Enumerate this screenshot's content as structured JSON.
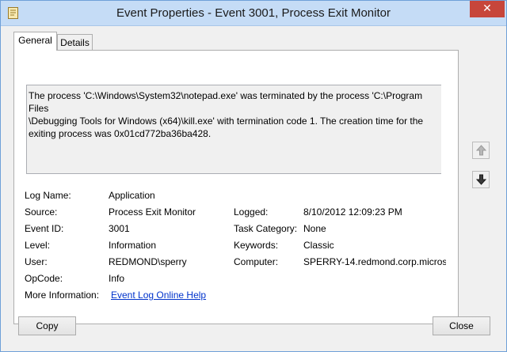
{
  "window": {
    "title": "Event Properties - Event 3001, Process Exit Monitor",
    "close_glyph": "✕"
  },
  "tabs": [
    {
      "label": "General",
      "active": true
    },
    {
      "label": "Details",
      "active": false
    }
  ],
  "event": {
    "description": "The process 'C:\\Windows\\System32\\notepad.exe' was terminated by the process 'C:\\Program Files\n\\Debugging Tools for Windows (x64)\\kill.exe' with termination code 1. The creation time for the\nexiting process was 0x01cd772ba36ba428.",
    "fields": {
      "log_name": {
        "label": "Log Name:",
        "value": "Application"
      },
      "source": {
        "label": "Source:",
        "value": "Process Exit Monitor"
      },
      "logged": {
        "label": "Logged:",
        "value": "8/10/2012 12:09:23 PM"
      },
      "event_id": {
        "label": "Event ID:",
        "value": "3001"
      },
      "task_category": {
        "label": "Task Category:",
        "value": "None"
      },
      "level": {
        "label": "Level:",
        "value": "Information"
      },
      "keywords": {
        "label": "Keywords:",
        "value": "Classic"
      },
      "user": {
        "label": "User:",
        "value": "REDMOND\\sperry"
      },
      "computer": {
        "label": "Computer:",
        "value": "SPERRY-14.redmond.corp.microso"
      },
      "opcode": {
        "label": "OpCode:",
        "value": "Info"
      },
      "more_info": {
        "label": "More Information:",
        "value": "Event Log Online Help"
      }
    }
  },
  "nav": {
    "up_icon": "arrow-up-icon",
    "down_icon": "arrow-down-icon"
  },
  "buttons": {
    "copy": "Copy",
    "close": "Close"
  },
  "colors": {
    "titlebar": "#c5dcf6",
    "close_button": "#c7463b",
    "link": "#0033cc"
  }
}
